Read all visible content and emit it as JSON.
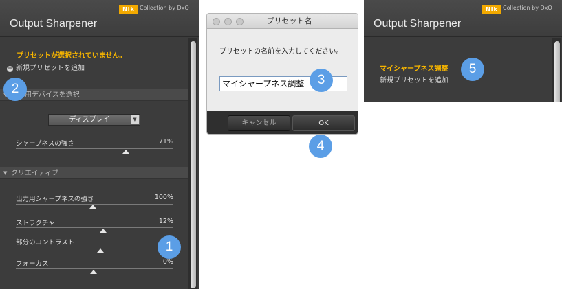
{
  "left_panel": {
    "title": "Output Sharpener",
    "brand_mark": "Nik",
    "brand_text": "Collection by DxO",
    "no_preset_message": "プリセットが選択されていません。",
    "add_preset_label": "新規プリセットを追加",
    "output_device_section": {
      "label": "出力用デバイスを選択",
      "dropdown_value": "ディスプレイ",
      "slider_label": "シャープネスの強さ",
      "slider_value": "71%"
    },
    "creative_section": {
      "label": "クリエイティブ",
      "sliders": [
        {
          "label": "出力用シャープネスの強さ",
          "value": "100%"
        },
        {
          "label": "ストラクチャ",
          "value": "12%"
        },
        {
          "label": "部分のコントラスト",
          "value": ""
        },
        {
          "label": "フォーカス",
          "value": "0%"
        }
      ]
    }
  },
  "dialog": {
    "title": "プリセット名",
    "prompt": "プリセットの名前を入力してください。",
    "input_value": "マイシャープネス調整",
    "cancel_label": "キャンセル",
    "ok_label": "OK"
  },
  "right_panel": {
    "title": "Output Sharpener",
    "brand_mark": "Nik",
    "brand_text": "Collection by DxO",
    "preset_name": "マイシャープネス調整",
    "add_preset_label": "新規プリセットを追加"
  },
  "callouts": [
    "1",
    "2",
    "3",
    "4",
    "5"
  ],
  "colors": {
    "panel_bg": "#3c3c3c",
    "accent_orange": "#f5b400",
    "callout_blue": "#5b9ee6",
    "dialog_bg": "#ececec"
  }
}
